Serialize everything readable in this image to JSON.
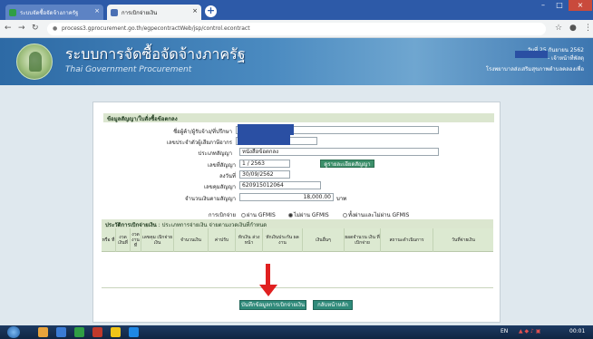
{
  "browser": {
    "tabs": [
      {
        "label": "ระบบจัดซื้อจัดจ้างภาครัฐ",
        "active": false
      },
      {
        "label": "การเบิกจ่ายเงิน",
        "active": true
      }
    ],
    "url": "process3.gprocurement.go.th/egpecontractWeb/jsp/control.econtract"
  },
  "site": {
    "title": "ระบบการจัดซื้อจัดจ้างภาครัฐ",
    "subtitle": "Thai Government Procurement",
    "date_text": "วันที่ 25 กันยายน 2562",
    "role_text": "- เจ้าหน้าที่พัสดุ",
    "org_text": "โรงพยาบาลส่งเสริมสุขภาพตำบลคลองเพื่อ"
  },
  "contract": {
    "section_title": "ข้อมูลสัญญา/ใบสั่งซื้อข้อตกลง",
    "fields": [
      {
        "label": "ชื่อผู้ค้า/ผู้รับจ้าง/ที่ปรึกษา",
        "value": ""
      },
      {
        "label": "เลขประจำตัวผู้เสียภาษีอากร",
        "value": ""
      },
      {
        "label": "ประเภทสัญญา",
        "value": "หนังสือข้อตกลง"
      },
      {
        "label": "เลขที่สัญญา",
        "value": "1 / 2563"
      },
      {
        "label": "ลงวันที่",
        "value": "30/09/2562"
      },
      {
        "label": "เลขคุมสัญญา",
        "value": "620915012064"
      },
      {
        "label": "จำนวนเงินตามสัญญา",
        "value": "18,000.00",
        "unit": "บาท"
      }
    ],
    "detail_button": "ดูรายละเอียดสัญญา",
    "disbursement_label": "การเบิกจ่าย",
    "disbursement_options": [
      {
        "label": "ผ่าน GFMIS",
        "selected": false
      },
      {
        "label": "ไม่ผ่าน GFMIS",
        "selected": true
      },
      {
        "label": "ทั้งผ่านและไม่ผ่าน GFMIS",
        "selected": false
      }
    ]
  },
  "history": {
    "title": "ประวัติการเบิกจ่ายเงิน",
    "subtitle": ": ประเภทการจ่ายเงิน จ่ายตามงวดเงินที่กำหนด",
    "columns": [
      "หรือ ที่",
      "งวด เงินที่",
      "งวด งาน ที่",
      "เลขคุม เบิกจ่ายเงิน",
      "จำนวนเงิน",
      "ค่าปรับ",
      "หักเงิน ล่วงหน้า",
      "หักเงินประกัน ผลงาน",
      "เงินอื่นๆ",
      "ยอดจำนวน เงิน ที่เบิกจ่าย",
      "สถานะดำเนินการ",
      "วันที่จ่ายเงิน"
    ],
    "rows": []
  },
  "actions": {
    "save_label": "บันทึกข้อมูลการเบิกจ่ายเงิน",
    "back_label": "กลับหน้าหลัก"
  },
  "taskbar": {
    "lang": "EN",
    "time": "00:01"
  },
  "colors": {
    "header_blue": "#2d6aa5",
    "section_green": "#dbe6cf",
    "button_teal": "#2f8a7a",
    "arrow_red": "#e02020",
    "redaction_blue": "#2a4fa3"
  }
}
